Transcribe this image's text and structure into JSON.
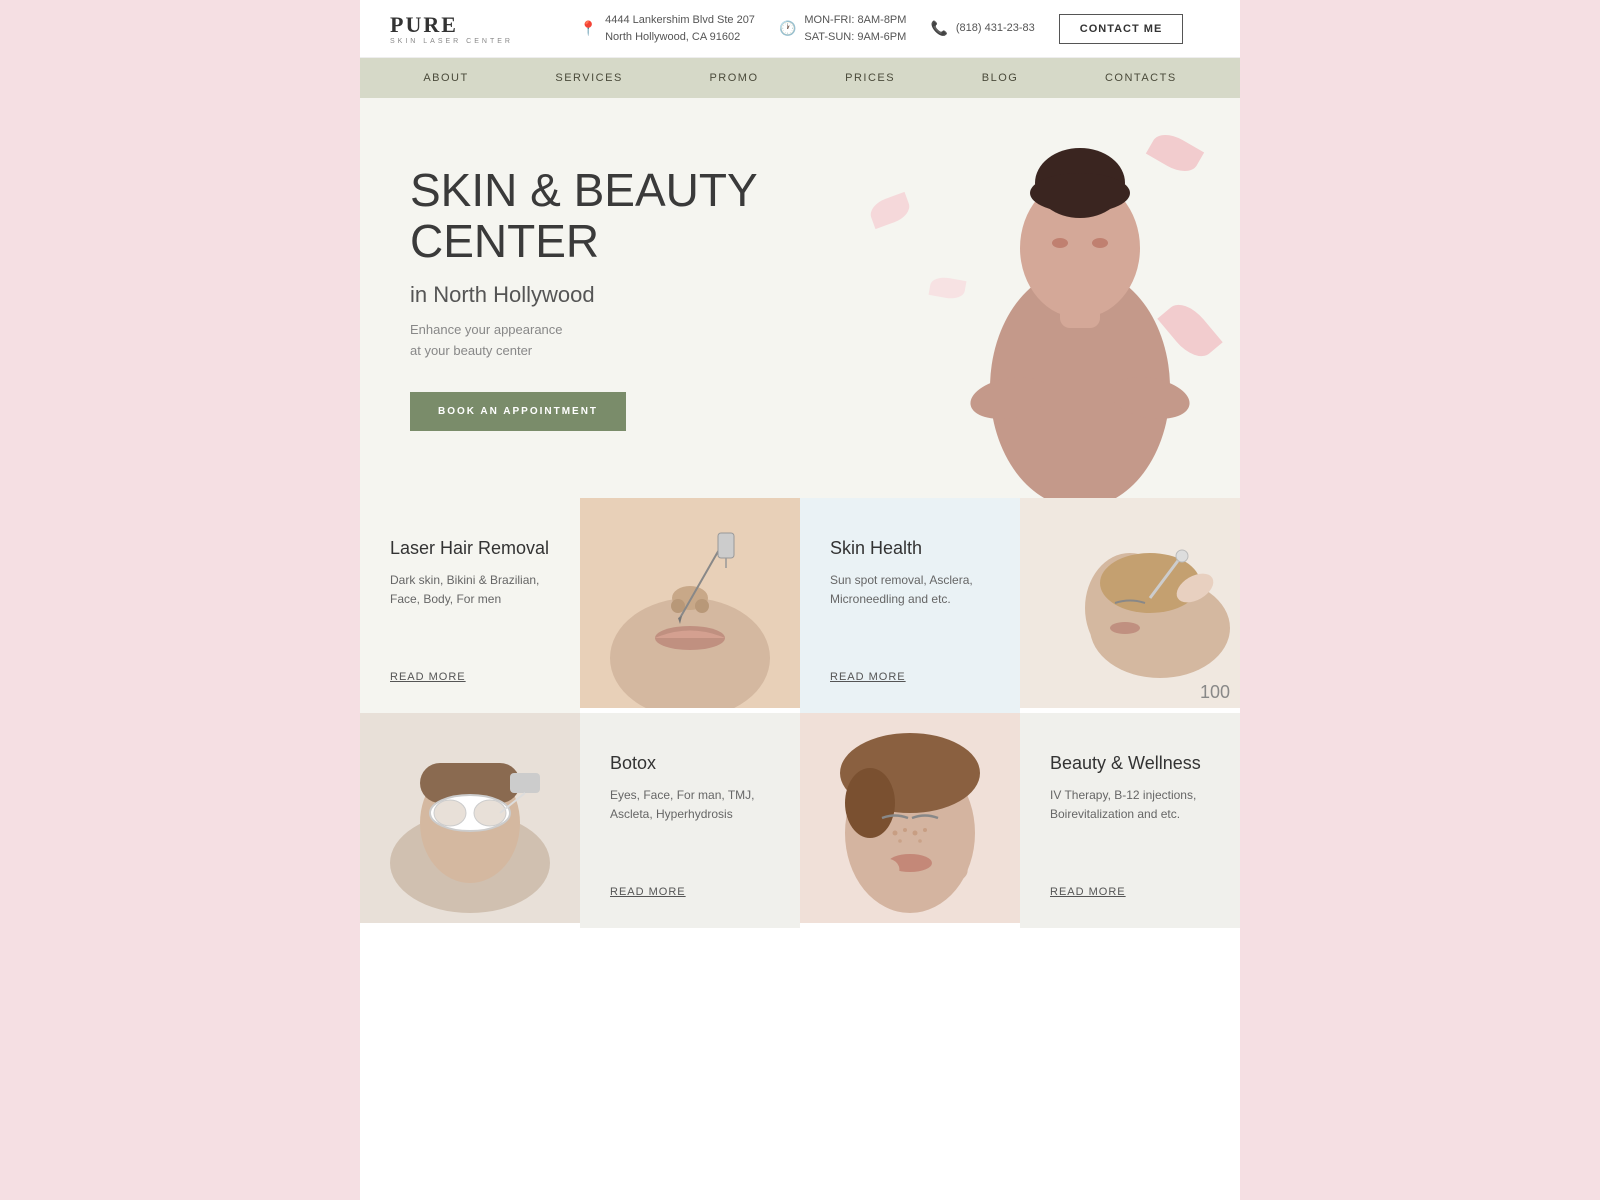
{
  "header": {
    "logo": {
      "name": "PURE",
      "sub": "SKIN LASER CENTER"
    },
    "address": {
      "line1": "4444 Lankershim Blvd Ste 207",
      "line2": "North Hollywood, CA 91602"
    },
    "hours": {
      "weekday": "MON-FRI: 8AM-8PM",
      "weekend": "SAT-SUN: 9AM-6PM"
    },
    "phone": "(818) 431-23-83",
    "contact_btn": "CONTACT ME"
  },
  "nav": {
    "items": [
      {
        "label": "ABOUT"
      },
      {
        "label": "SERVICES"
      },
      {
        "label": "PROMO"
      },
      {
        "label": "PRICES"
      },
      {
        "label": "BLOG"
      },
      {
        "label": "CONTACTS"
      }
    ]
  },
  "hero": {
    "title": "SKIN & BEAUTY CENTER",
    "subtitle": "in North Hollywood",
    "description_line1": "Enhance your appearance",
    "description_line2": "at your beauty center",
    "book_btn": "BOOK AN APPOINTMENT"
  },
  "services": [
    {
      "id": "laser",
      "title": "Laser Hair Removal",
      "desc_line1": "Dark skin, Bikini & Brazilian,",
      "desc_line2": "Face, Body, For men",
      "read_more": "READ MORE",
      "type": "text",
      "bg": "light"
    },
    {
      "id": "laser-img",
      "type": "image",
      "img_class": "needle-img"
    },
    {
      "id": "skin",
      "title": "Skin Health",
      "desc_line1": "Sun spot removal, Asclera,",
      "desc_line2": "Microneedling and etc.",
      "read_more": "READ MORE",
      "type": "text",
      "bg": "blue"
    },
    {
      "id": "skin-img",
      "type": "image",
      "img_class": "skin-img"
    }
  ],
  "services_row2": [
    {
      "id": "laser-treat-img",
      "type": "image",
      "img_class": "laser-img"
    },
    {
      "id": "botox",
      "title": "Botox",
      "desc_line1": "Eyes, Face, For man, TMJ,",
      "desc_line2": "Ascleta, Hyperhydrosis",
      "read_more": "READ MORE",
      "type": "text",
      "bg": "white"
    },
    {
      "id": "beauty-img",
      "type": "image",
      "img_class": "beauty-img"
    },
    {
      "id": "beauty",
      "title": "Beauty & Wellness",
      "desc_line1": "IV Therapy, B-12 injections,",
      "desc_line2": "Boirevitalization and etc.",
      "read_more": "READ MORE",
      "type": "text",
      "bg": "white"
    }
  ],
  "colors": {
    "nav_bg": "#d6d9c8",
    "hero_bg": "#f5f5f0",
    "btn_green": "#7a8c6a",
    "card_blue": "#eaf2f5",
    "card_light": "#f5f5f0",
    "accent_pink": "#f0b0b8"
  }
}
